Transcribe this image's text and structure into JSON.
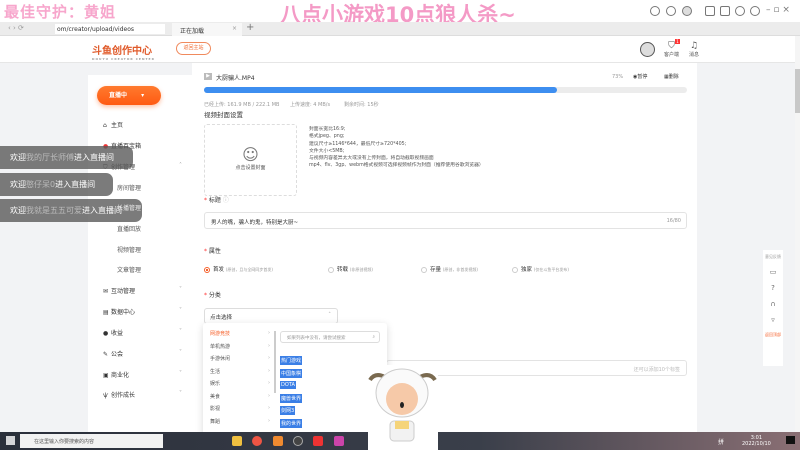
{
  "overlay": {
    "left_text": "最佳守护：黄姐",
    "title": "八点小游戏10点狼人杀~"
  },
  "browser": {
    "url": "om/creator/upload/videos",
    "tab_label": "正在加载",
    "new_tab": "+",
    "close": "×"
  },
  "header": {
    "logo": "斗鱼创作中心",
    "logo_sub": "DOUYU CREATOR CENTER",
    "back_button": "返回主站",
    "icons": [
      {
        "name": "customer-service",
        "label": "客户端"
      },
      {
        "name": "notice",
        "label": "消息"
      }
    ],
    "badge": "1"
  },
  "sidebar": {
    "live_button": "直播中",
    "items": [
      {
        "label": "主页",
        "icon": "home"
      },
      {
        "label": "直播百宝箱",
        "icon": "toolbox"
      },
      {
        "label": "创作管理",
        "icon": "shield",
        "expanded": true
      }
    ],
    "sub_items": [
      "房间管理",
      "长播管理",
      "直播回放",
      "视频管理",
      "文章管理"
    ],
    "more_items": [
      {
        "label": "互动管理"
      },
      {
        "label": "数据中心"
      },
      {
        "label": "收益"
      },
      {
        "label": "公会"
      },
      {
        "label": "商业化"
      },
      {
        "label": "创作成长"
      }
    ]
  },
  "toasts": [
    {
      "prefix": "欢迎",
      "user": "我的厅长师傅",
      "suffix": "进入直播间"
    },
    {
      "prefix": "欢迎",
      "user": "憨仔呆0",
      "suffix": "进入直播间"
    },
    {
      "prefix": "欢迎",
      "user": "我就是五五可爱",
      "suffix": "进入直播间"
    }
  ],
  "upload": {
    "filename": "大厨骗人.MP4",
    "percent_text": "73%",
    "progress": 73,
    "pause": "暂停",
    "delete": "删除",
    "uploaded": "已经上传: 161.9 MB / 222.1 MB",
    "speed": "上传速度: 4 MB/s",
    "remaining": "剩余时间: 15秒"
  },
  "cover": {
    "section_title": "视频封面设置",
    "button": "点击设置封面",
    "rules": [
      "封面长宽比16:9;",
      "格式jpeg、png;",
      "建议尺寸≥1146*644，最低尺寸≥720*405;",
      "文件大小<5MB;",
      "与视频内容差异太大或没有上传封面，将自动截取视频画面",
      "mp4、flv、3gp、webm格式视频可选择视频帧作为封面（推荐使用谷歌浏览器）"
    ]
  },
  "title_field": {
    "label": "标题",
    "value": "男人的嘴，骗人的鬼，特别是大厨~",
    "count": "16/80"
  },
  "attribute": {
    "label": "属性",
    "options": [
      {
        "label": "首发",
        "hint": "(原创，且与全网同步首发)",
        "checked": true
      },
      {
        "label": "转载",
        "hint": "(非原创视频)",
        "checked": false
      },
      {
        "label": "存量",
        "hint": "(原创，非首发视频)",
        "checked": false
      },
      {
        "label": "独家",
        "hint": "(仅在斗鱼平台发布)",
        "checked": false
      }
    ]
  },
  "category": {
    "label": "分类",
    "placeholder": "点击选择",
    "left": [
      "网游竞技",
      "单机热游",
      "手游休闲",
      "生活",
      "娱乐",
      "美食",
      "影视",
      "舞蹈"
    ],
    "search_placeholder": "如果列表中没有，请尝试搜索",
    "right": [
      "热门游戏",
      "中国象棋",
      "DOTA",
      "魔兽世界",
      "剑网3",
      "我的世界"
    ]
  },
  "tags": {
    "placeholder": "还可以添加10个标签"
  },
  "right_bar": {
    "feedback": "意见反馈",
    "back_top": "返回顶部"
  },
  "taskbar": {
    "search": "在这里输入你要搜索的内容",
    "time": "3:01",
    "date": "2022/10/10",
    "lang": "拼"
  }
}
